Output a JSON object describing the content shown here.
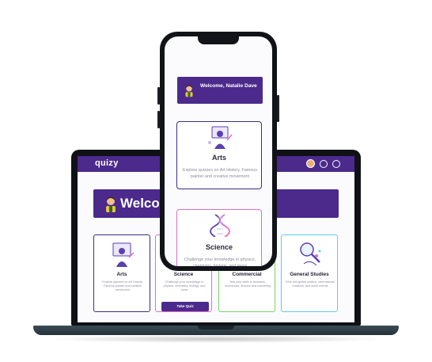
{
  "laptop": {
    "logo": "quizy",
    "banner_title": "Welcome, Natalie Dave",
    "cards": [
      {
        "title": "Arts",
        "description": "Explore quizzes on Art History, Famous painter and creative movement"
      },
      {
        "title": "Science",
        "description": "Challenge your knowledge in physics, chemistry, biology, and more"
      },
      {
        "title": "Commercial",
        "description": "Test your skills in business, economics, finance and marketing"
      },
      {
        "title": "General Studies",
        "description": "Dive into global politics, international relations, and world events"
      }
    ],
    "take_quiz_label": "Take Quiz"
  },
  "phone": {
    "banner_title": "Welcome, Natalie Dave",
    "cards": [
      {
        "title": "Arts",
        "description": "Explore quizzes on Art History, Famous painter and creative movement"
      },
      {
        "title": "Science",
        "description": "Challenge your knowledge in physics, chemistry, biology, and more"
      }
    ]
  },
  "icons": {
    "nav": [
      "avatar",
      "shield-icon",
      "help-icon"
    ],
    "cards": [
      "painter-icon",
      "dna-icon",
      "chart-icon",
      "globe-magnifier-icon"
    ]
  },
  "colors": {
    "brand_purple": "#4b2a8c",
    "arts_border": "#3b2e87",
    "science_border": "#e06cc8",
    "commercial_border": "#7ed36a",
    "general_border": "#5bd0e8",
    "laptop_body": "#0f1116",
    "laptop_base": "#34444e"
  }
}
